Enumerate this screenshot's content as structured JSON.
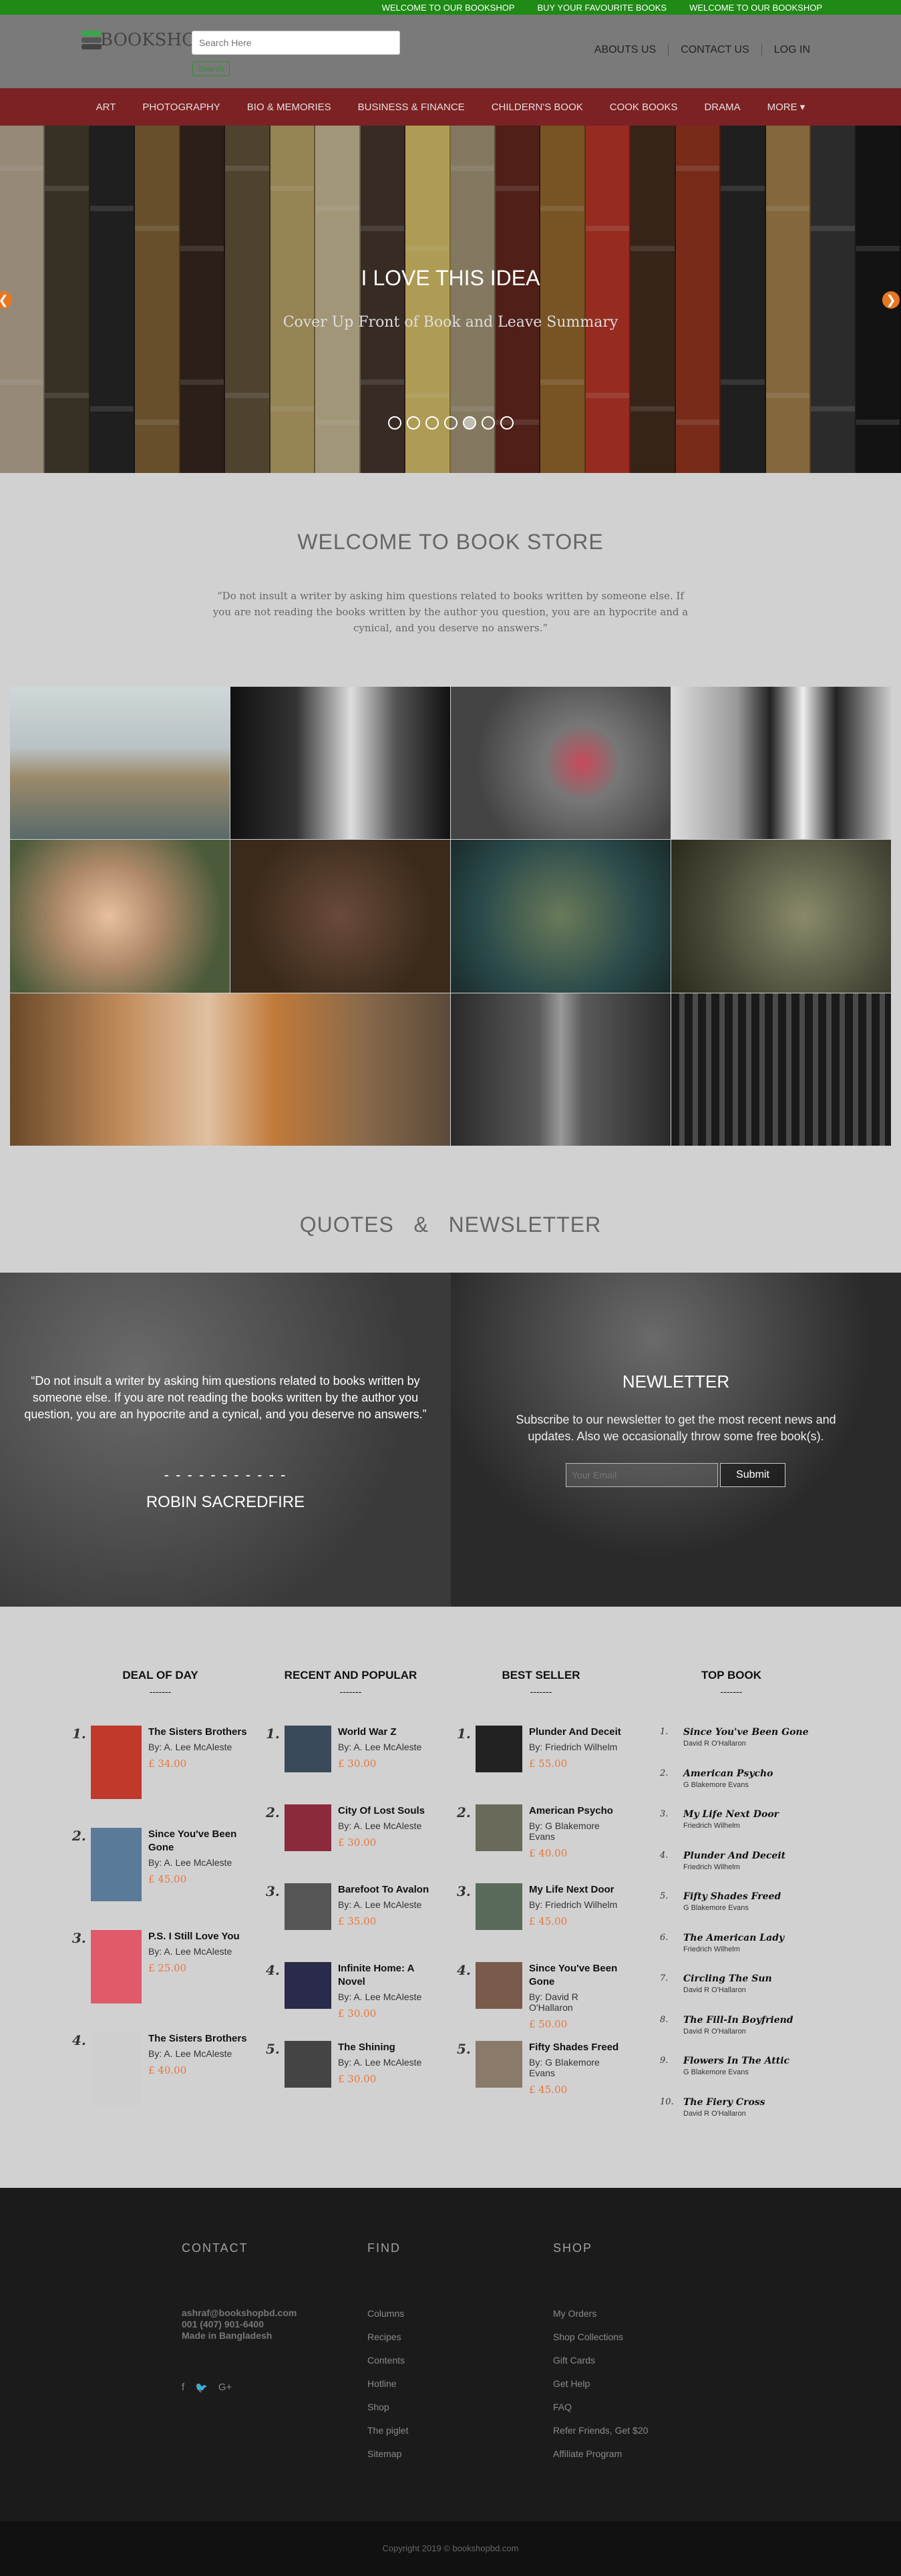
{
  "topbar": [
    "WELCOME TO OUR BOOKSHOP",
    "BUY YOUR FAVOURITE BOOKS",
    "WELCOME TO OUR BOOKSHOP"
  ],
  "header": {
    "logo": "BOOKSHOP",
    "search_placeholder": "Search Here",
    "search_button": "Search",
    "nav": [
      "ABOUTS US",
      "CONTACT US",
      "LOG IN"
    ]
  },
  "menu": [
    "ART",
    "PHOTOGRAPHY",
    "BIO & MEMORIES",
    "BUSINESS & FINANCE",
    "CHILDERN'S BOOK",
    "COOK BOOKS",
    "DRAMA",
    "MORE ▾"
  ],
  "hero": {
    "title": "I LOVE THIS IDEA",
    "subtitle": "Cover Up Front of Book and Leave Summary",
    "prev": "❮",
    "next": "❯",
    "slides": 7,
    "active_slide": 5
  },
  "welcome": {
    "title": "WELCOME TO BOOK STORE",
    "quote": "“Do not insult a writer by asking him questions related to books written by someone else. If you are not reading the books written by the author you question, you are an hypocrite and a cynical, and you deserve no answers.”"
  },
  "section2_title": "QUOTES   &   NEWSLETTER",
  "quote": {
    "text": "“Do not insult a writer by asking him questions related to books written by someone else. If you are not reading the books written by the author you question, you are an hypocrite and a cynical, and you deserve no answers.”",
    "dash": "- - - - - - - - - - -",
    "author": "ROBIN SACREDFIRE"
  },
  "newsletter": {
    "title": "NEWLETTER",
    "text": "Subscribe to our newsletter to get the most recent news and updates. Also we occasionally throw some free book(s).",
    "placeholder": "Your Email",
    "button": "Submit"
  },
  "deal": {
    "title": "DEAL OF DAY",
    "underline": "-------",
    "items": [
      {
        "n": "1.",
        "t": "The Sisters Brothers",
        "a": "By: A. Lee McAleste",
        "p": "£ 34.00",
        "c": "#c0392b"
      },
      {
        "n": "2.",
        "t": "Since You've Been Gone",
        "a": "By: A. Lee McAleste",
        "p": "£ 45.00",
        "c": "#5a7a9a"
      },
      {
        "n": "3.",
        "t": "P.S. I Still Love You",
        "a": "By: A. Lee McAleste",
        "p": "£ 25.00",
        "c": "#e05a6a"
      },
      {
        "n": "4.",
        "t": "The Sisters Brothers",
        "a": "By: A. Lee McAleste",
        "p": "£ 40.00",
        "c": "#cfcfcf"
      }
    ]
  },
  "recent": {
    "title": "RECENT AND POPULAR",
    "underline": "-------",
    "items": [
      {
        "n": "1.",
        "t": "World War Z",
        "a": "By: A. Lee McAleste",
        "p": "£ 30.00",
        "c": "#3a4a5a"
      },
      {
        "n": "2.",
        "t": "City Of Lost Souls",
        "a": "By: A. Lee McAleste",
        "p": "£ 30.00",
        "c": "#8a2a3a"
      },
      {
        "n": "3.",
        "t": "Barefoot To Avalon",
        "a": "By: A. Lee McAleste",
        "p": "£ 35.00",
        "c": "#555"
      },
      {
        "n": "4.",
        "t": "Infinite Home: A Novel",
        "a": "By: A. Lee McAleste",
        "p": "£ 30.00",
        "c": "#2a2a4a"
      },
      {
        "n": "5.",
        "t": "The Shining",
        "a": "By: A. Lee McAleste",
        "p": "£ 30.00",
        "c": "#444"
      }
    ]
  },
  "best": {
    "title": "BEST SELLER",
    "underline": "-------",
    "items": [
      {
        "n": "1.",
        "t": "Plunder And Deceit",
        "a": "By: Friedrich Wilhelm",
        "p": "£ 55.00",
        "c": "#222"
      },
      {
        "n": "2.",
        "t": "American Psycho",
        "a": "By: G Blakemore Evans",
        "p": "£ 40.00",
        "c": "#6a6a5a"
      },
      {
        "n": "3.",
        "t": "My Life Next Door",
        "a": "By: Friedrich Wilhelm",
        "p": "£ 45.00",
        "c": "#5a6a5a"
      },
      {
        "n": "4.",
        "t": "Since You've Been Gone",
        "a": "By: David R O'Hallaron",
        "p": "£ 50.00",
        "c": "#7a5a4a"
      },
      {
        "n": "5.",
        "t": "Fifty Shades Freed",
        "a": "By: G Blakemore Evans",
        "p": "£ 45.00",
        "c": "#8a7a6a"
      }
    ]
  },
  "top": {
    "title": "TOP BOOK",
    "underline": "-------",
    "items": [
      {
        "n": "1.",
        "t": "Since You've Been Gone",
        "a": "David R O'Hallaron"
      },
      {
        "n": "2.",
        "t": "American Psycho",
        "a": "G Blakemore Evans"
      },
      {
        "n": "3.",
        "t": "My Life Next Door",
        "a": "Friedrich Wilhelm"
      },
      {
        "n": "4.",
        "t": "Plunder And Deceit",
        "a": "Friedrich Wilhelm"
      },
      {
        "n": "5.",
        "t": "Fifty Shades Freed",
        "a": "G Blakemore Evans"
      },
      {
        "n": "6.",
        "t": "The American Lady",
        "a": "Friedrich Wilhelm"
      },
      {
        "n": "7.",
        "t": "Circling The Sun",
        "a": "David R O'Hallaron"
      },
      {
        "n": "8.",
        "t": "The Fill-In Boyfriend",
        "a": "David R O'Hallaron"
      },
      {
        "n": "9.",
        "t": "Flowers In The Attic",
        "a": "G Blakemore Evans"
      },
      {
        "n": "10.",
        "t": "The Fiery Cross",
        "a": "David R O'Hallaron"
      }
    ]
  },
  "footer": {
    "contact": {
      "title": "CONTACT",
      "lines": [
        "ashraf@bookshopbd.com",
        "001 (407) 901-6400",
        "Made in Bangladesh"
      ],
      "social": [
        "f",
        "🐦",
        "G+"
      ]
    },
    "find": {
      "title": "FIND",
      "links": [
        "Columns",
        "Recipes",
        "Contents",
        "Hotline",
        "Shop",
        "The piglet",
        "Sitemap"
      ]
    },
    "shop": {
      "title": "SHOP",
      "links": [
        "My Orders",
        "Shop Collections",
        "Gift Cards",
        "Get Help",
        "FAQ",
        "Refer Friends, Get $20",
        "Affiliate Program"
      ]
    }
  },
  "copyright": "Copyright 2019 © bookshopbd.com"
}
